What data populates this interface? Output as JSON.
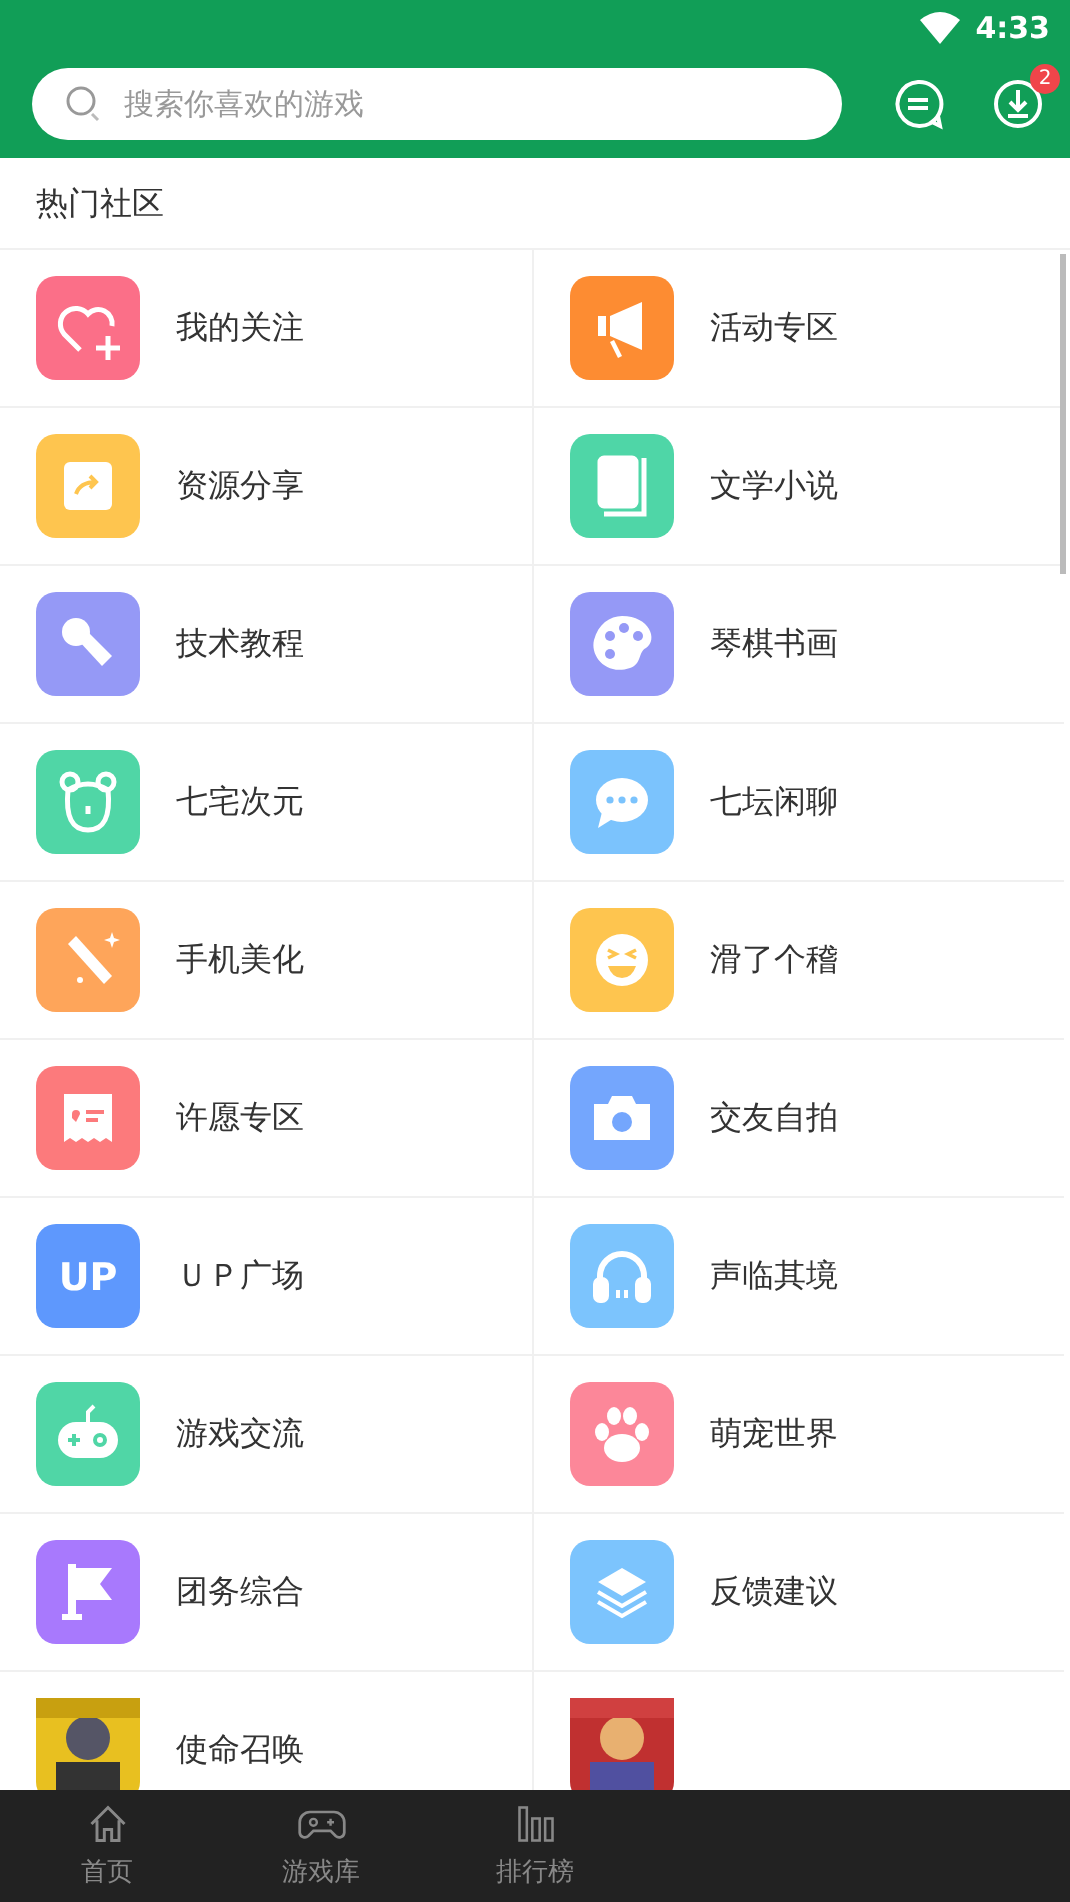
{
  "status_bar": {
    "time": "4:33"
  },
  "search": {
    "placeholder": "搜索你喜欢的游戏"
  },
  "download_badge": "2",
  "section": {
    "title": "热门社区"
  },
  "communities": [
    {
      "name": "我的关注",
      "color": "#fb6f88"
    },
    {
      "name": "活动专区",
      "color": "#fd8c32"
    },
    {
      "name": "资源分享",
      "color": "#fec54f"
    },
    {
      "name": "文学小说",
      "color": "#4fd6a7"
    },
    {
      "name": "技术教程",
      "color": "#9599f6"
    },
    {
      "name": "琴棋书画",
      "color": "#9599f6"
    },
    {
      "name": "七宅次元",
      "color": "#50d6a6"
    },
    {
      "name": "七坛闲聊",
      "color": "#7bc3fd"
    },
    {
      "name": "手机美化",
      "color": "#fea55a"
    },
    {
      "name": "滑了个稽",
      "color": "#fec54f"
    },
    {
      "name": "许愿专区",
      "color": "#fc7a7c"
    },
    {
      "name": "交友自拍",
      "color": "#74a6fd"
    },
    {
      "name": "ＵＰ广场",
      "color": "#5e98fd",
      "icon_text": "UP"
    },
    {
      "name": "声临其境",
      "color": "#7cc4fd"
    },
    {
      "name": "游戏交流",
      "color": "#50d6a6"
    },
    {
      "name": "萌宠世界",
      "color": "#fc8799"
    },
    {
      "name": "团务综合",
      "color": "#a879fd"
    },
    {
      "name": "反馈建议",
      "color": "#7cc4fd"
    },
    {
      "name": "使命召唤",
      "kind": "picture"
    },
    {
      "kind": "picture"
    }
  ],
  "bottom_nav": [
    {
      "label": "首页"
    },
    {
      "label": "游戏库"
    },
    {
      "label": "排行榜"
    }
  ]
}
